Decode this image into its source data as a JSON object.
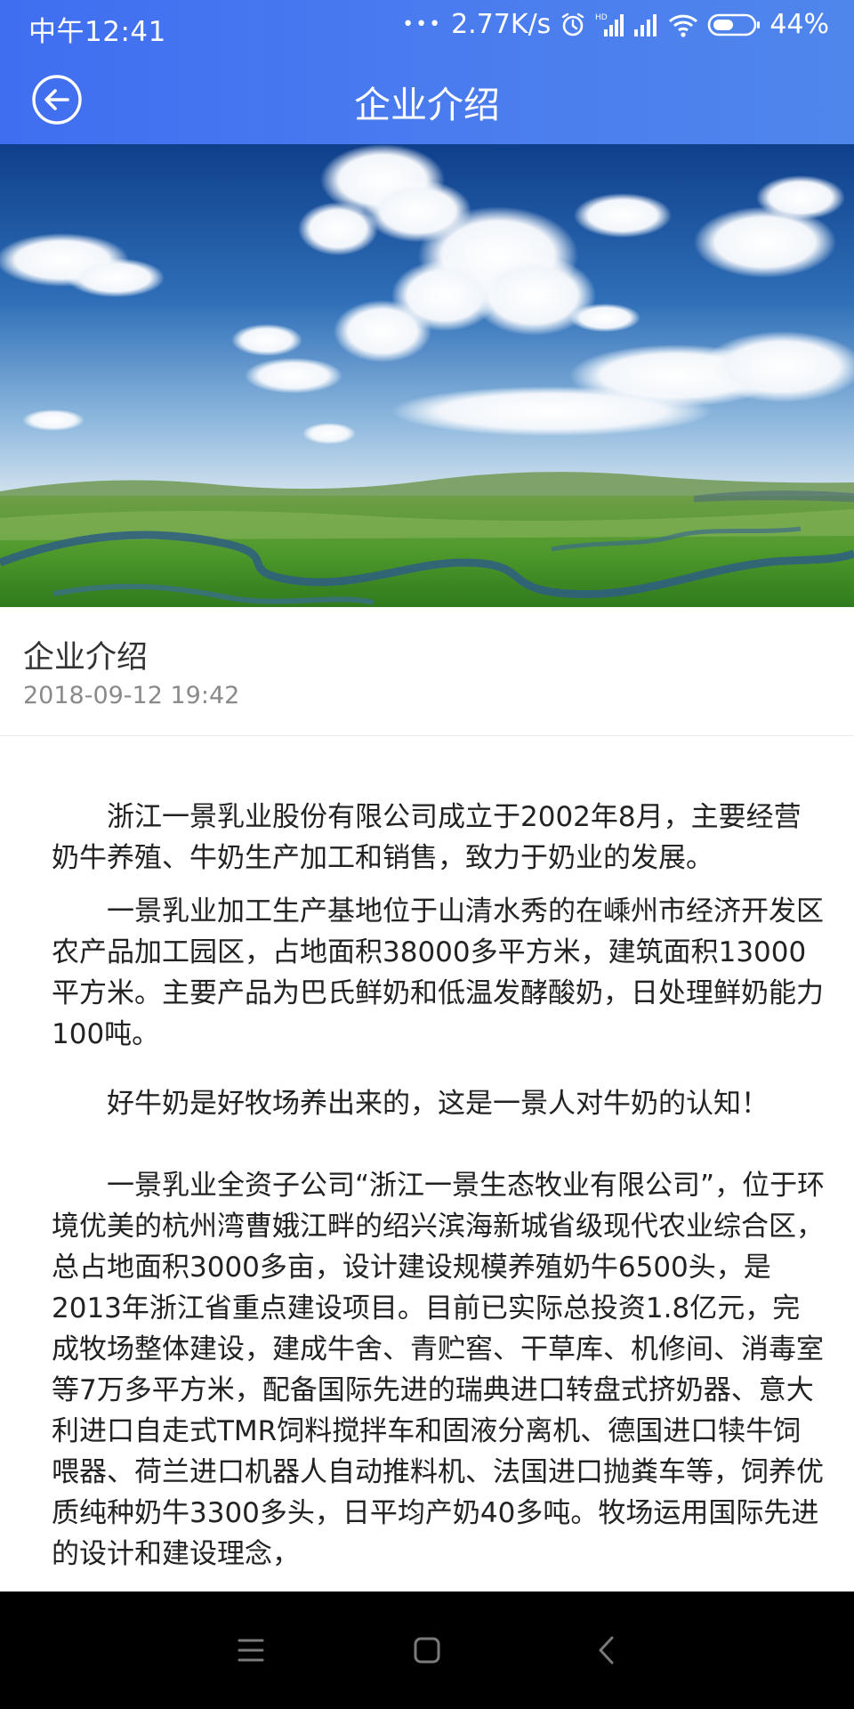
{
  "status_bar": {
    "time": "中午12:41",
    "dots": "•••",
    "network_speed": "2.77K/s",
    "battery": "44%",
    "icons": [
      "alarm-icon",
      "hd-signal-icon",
      "signal-icon",
      "wifi-icon",
      "battery-icon"
    ]
  },
  "header": {
    "title": "企业介绍",
    "back_icon": "back-arrow-circle-icon",
    "gradient_colors": [
      "#3f6ef0",
      "#4f86ec"
    ]
  },
  "hero": {
    "image": "landscape-grassland-river-sky-clouds"
  },
  "article": {
    "title": "企业介绍",
    "date": "2018-09-12 19:42",
    "paragraphs": [
      "浙江一景乳业股份有限公司成立于2002年8月，主要经营奶牛养殖、牛奶生产加工和销售，致力于奶业的发展。",
      "一景乳业加工生产基地位于山清水秀的在嵊州市经济开发区农产品加工园区，占地面积38000多平方米，建筑面积13000平方米。主要产品为巴氏鲜奶和低温发酵酸奶，日处理鲜奶能力100吨。",
      "好牛奶是好牧场养出来的，这是一景人对牛奶的认知！",
      "一景乳业全资子公司“浙江一景生态牧业有限公司”，位于环境优美的杭州湾曹娥江畔的绍兴滨海新城省级现代农业综合区，总占地面积3000多亩，设计建设规模养殖奶牛6500头，是2013年浙江省重点建设项目。目前已实际总投资1.8亿元，完成牧场整体建设，建成牛舍、青贮窖、干草库、机修间、消毒室等7万多平方米，配备国际先进的瑞典进口转盘式挤奶器、意大利进口自走式TMR饲料搅拌车和固液分离机、德国进口犊牛饲喂器、荷兰进口机器人自动推料机、法国进口抛粪车等，饲养优质纯种奶牛3300多头，日平均产奶40多吨。牧场运用国际先进的设计和建设理念，"
    ]
  },
  "nav_bar": {
    "buttons": [
      "menu-icon",
      "home-icon",
      "back-icon"
    ]
  }
}
